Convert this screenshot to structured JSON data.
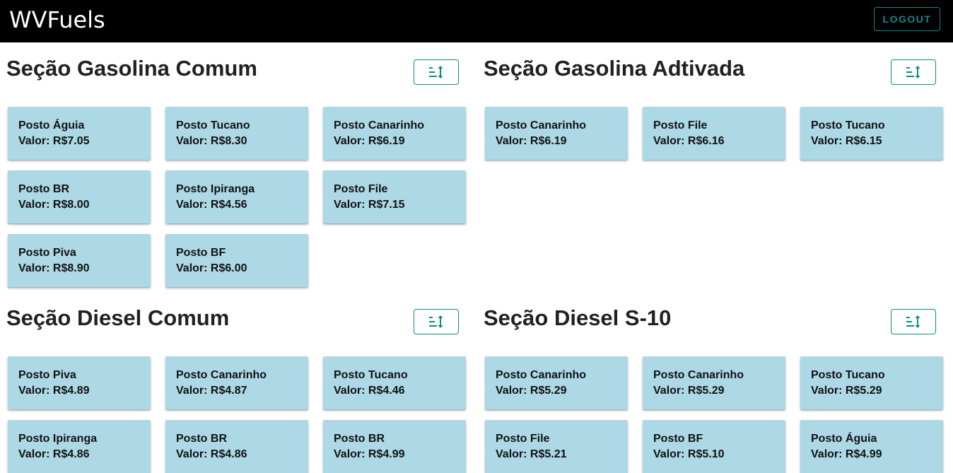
{
  "app": {
    "title": "WVFuels",
    "logout_label": "LOGOUT"
  },
  "colors": {
    "topbar": "#000000",
    "accent": "#0e8a86",
    "card": "#add8e6"
  },
  "sections": [
    {
      "title": "Seção Gasolina Comum",
      "sort_icon": "sort-icon",
      "stations": [
        {
          "name": "Posto Águia",
          "value": "Valor: R$7.05"
        },
        {
          "name": "Posto Tucano",
          "value": "Valor: R$8.30"
        },
        {
          "name": "Posto Canarinho",
          "value": "Valor: R$6.19"
        },
        {
          "name": "Posto BR",
          "value": "Valor: R$8.00"
        },
        {
          "name": "Posto Ipiranga",
          "value": "Valor: R$4.56"
        },
        {
          "name": "Posto File",
          "value": "Valor: R$7.15"
        },
        {
          "name": "Posto Piva",
          "value": "Valor: R$8.90"
        },
        {
          "name": "Posto BF",
          "value": "Valor: R$6.00"
        }
      ]
    },
    {
      "title": "Seção Gasolina Adtivada",
      "sort_icon": "sort-icon",
      "stations": [
        {
          "name": "Posto Canarinho",
          "value": "Valor: R$6.19"
        },
        {
          "name": "Posto File",
          "value": "Valor: R$6.16"
        },
        {
          "name": "Posto Tucano",
          "value": "Valor: R$6.15"
        }
      ]
    },
    {
      "title": "Seção Diesel Comum",
      "sort_icon": "sort-icon",
      "stations": [
        {
          "name": "Posto Piva",
          "value": "Valor: R$4.89"
        },
        {
          "name": "Posto Canarinho",
          "value": "Valor: R$4.87"
        },
        {
          "name": "Posto Tucano",
          "value": "Valor: R$4.46"
        },
        {
          "name": "Posto Ipiranga",
          "value": "Valor: R$4.86"
        },
        {
          "name": "Posto BR",
          "value": "Valor: R$4.86"
        },
        {
          "name": "Posto BR",
          "value": "Valor: R$4.99"
        }
      ]
    },
    {
      "title": "Seção Diesel S-10",
      "sort_icon": "sort-icon",
      "stations": [
        {
          "name": "Posto Canarinho",
          "value": "Valor: R$5.29"
        },
        {
          "name": "Posto Canarinho",
          "value": "Valor: R$5.29"
        },
        {
          "name": "Posto Tucano",
          "value": "Valor: R$5.29"
        },
        {
          "name": "Posto File",
          "value": "Valor: R$5.21"
        },
        {
          "name": "Posto BF",
          "value": "Valor: R$5.10"
        },
        {
          "name": "Posto Águia",
          "value": "Valor: R$4.99"
        }
      ]
    }
  ]
}
